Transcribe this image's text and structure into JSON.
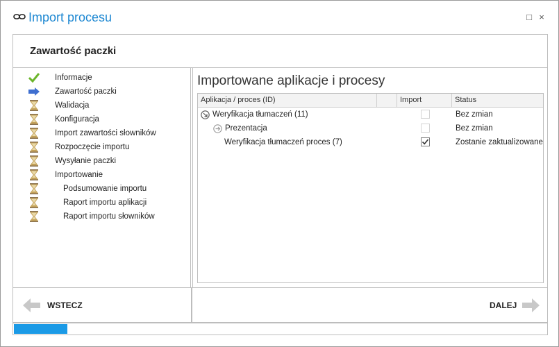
{
  "window": {
    "title": "Import procesu",
    "maximize_glyph": "□",
    "close_glyph": "×"
  },
  "header": {
    "title": "Zawartość paczki"
  },
  "steps": [
    {
      "label": "Informacje",
      "icon": "check-icon",
      "state": "done",
      "indent": 1
    },
    {
      "label": "Zawartość paczki",
      "icon": "arrow-right-icon",
      "state": "current",
      "indent": 1
    },
    {
      "label": "Walidacja",
      "icon": "hourglass-icon",
      "state": "pending",
      "indent": 1
    },
    {
      "label": "Konfiguracja",
      "icon": "hourglass-icon",
      "state": "pending",
      "indent": 1
    },
    {
      "label": "Import zawartości słowników",
      "icon": "hourglass-icon",
      "state": "pending",
      "indent": 1
    },
    {
      "label": "Rozpoczęcie importu",
      "icon": "hourglass-icon",
      "state": "pending",
      "indent": 1
    },
    {
      "label": "Wysyłanie paczki",
      "icon": "hourglass-icon",
      "state": "pending",
      "indent": 1
    },
    {
      "label": "Importowanie",
      "icon": "hourglass-icon",
      "state": "pending",
      "indent": 1
    },
    {
      "label": "Podsumowanie importu",
      "icon": "hourglass-icon",
      "state": "pending",
      "indent": 2
    },
    {
      "label": "Raport importu aplikacji",
      "icon": "hourglass-icon",
      "state": "pending",
      "indent": 2
    },
    {
      "label": "Raport importu słowników",
      "icon": "hourglass-icon",
      "state": "pending",
      "indent": 2
    }
  ],
  "content": {
    "title": "Importowane aplikacje i procesy",
    "columns": [
      "Aplikacja / proces (ID)",
      "",
      "Import",
      "Status"
    ],
    "rows": [
      {
        "name": "Weryfikacja tłumaczeń (11)",
        "level": 0,
        "expand": "collapse-icon",
        "import_checked": false,
        "import_enabled": false,
        "status": "Bez zmian"
      },
      {
        "name": "Prezentacja",
        "level": 1,
        "expand": "expand-icon",
        "import_checked": false,
        "import_enabled": false,
        "status": "Bez zmian"
      },
      {
        "name": "Weryfikacja tłumaczeń proces (7)",
        "level": 2,
        "expand": "",
        "import_checked": true,
        "import_enabled": true,
        "status": "Zostanie zaktualizowane"
      }
    ]
  },
  "footer": {
    "back_label": "WSTECZ",
    "next_label": "DALEJ"
  },
  "progress": {
    "fraction": 0.1
  },
  "colors": {
    "accent": "#1e88d2",
    "progress": "#1b9ae6",
    "check": "#6bb52a",
    "arrow": "#3f6fd0",
    "hourglass": "#c4a25a",
    "nav_arrow": "#c8c8c8"
  }
}
